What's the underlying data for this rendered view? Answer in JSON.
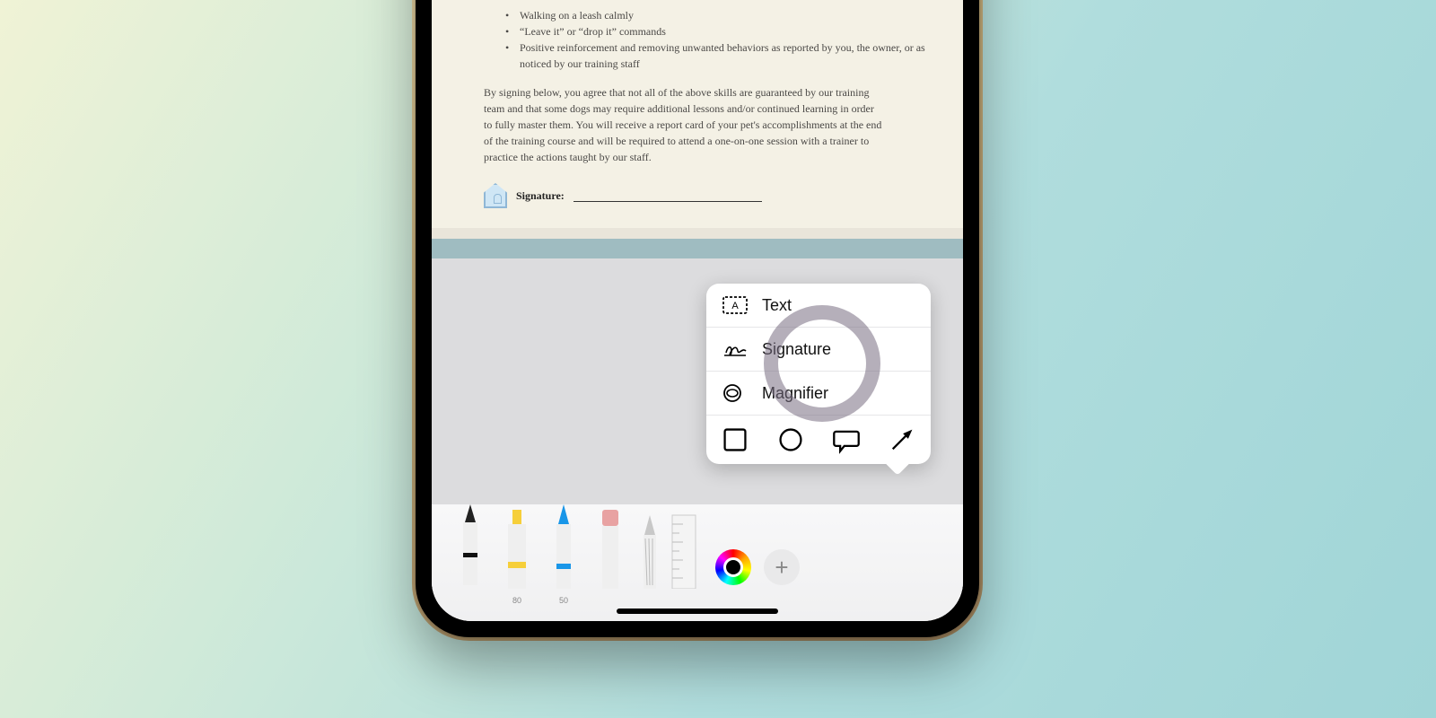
{
  "document": {
    "bullets": [
      "Walking on a leash calmly",
      "“Leave it” or “drop it” commands",
      "Positive reinforcement and removing unwanted behaviors as reported by you, the owner, or as noticed by our training staff"
    ],
    "paragraph": "By signing below, you agree that not all of the above skills are guaranteed by our training team and that some dogs may require additional lessons and/or continued learning in order to fully master them. You will receive a report card of your pet's accomplishments at the end of the training course and will be required to attend a one-on-one session with a trainer to practice the actions taught by our staff.",
    "signature_label": "Signature:"
  },
  "popover": {
    "items": [
      {
        "label": "Text"
      },
      {
        "label": "Signature"
      },
      {
        "label": "Magnifier"
      }
    ]
  },
  "tools": {
    "highlighter_size": "80",
    "pencil_size": "50"
  }
}
